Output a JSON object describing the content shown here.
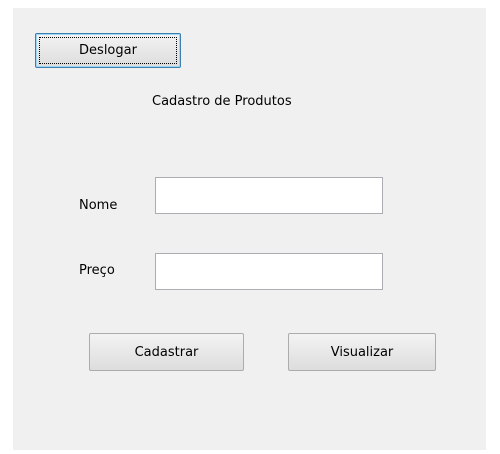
{
  "form": {
    "title": "Cadastro de Produtos",
    "logout_label": "Deslogar",
    "nome_label": "Nome",
    "nome_value": "",
    "preco_label": "Preço",
    "preco_value": "",
    "cadastrar_label": "Cadastrar",
    "visualizar_label": "Visualizar"
  }
}
